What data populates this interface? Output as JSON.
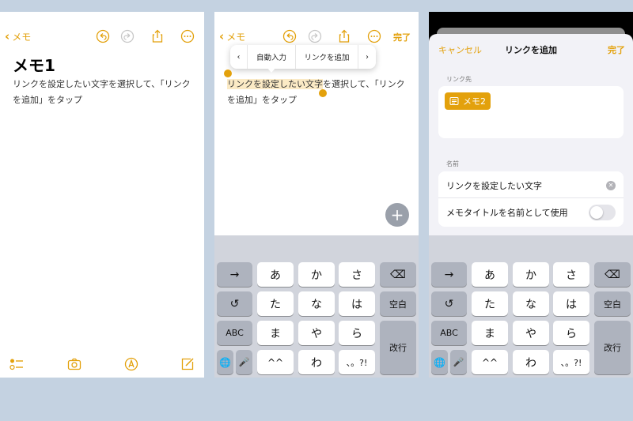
{
  "accent_color": "#e3a10c",
  "panel1": {
    "back_label": "メモ",
    "title": "メモ1",
    "body": "リンクを設定したい文字を選択して、「リンクを追加」をタップ",
    "icons": [
      "undo-icon",
      "redo-icon",
      "share-icon",
      "more-icon",
      "checklist-icon",
      "camera-icon",
      "markup-icon",
      "compose-icon"
    ]
  },
  "panel2": {
    "back_label": "メモ",
    "done_label": "完了",
    "menu": {
      "prev": "‹",
      "autofill": "自動入力",
      "add_link": "リンクを追加",
      "next": "›"
    },
    "selected_text": "リンクを設定したい文字",
    "body_rest_1": "を選択して、「リンク",
    "body_rest_2": "を追加」をタップ",
    "fab": "+"
  },
  "keyboard": {
    "arrow": "→",
    "undo": "↺",
    "abc": "ABC",
    "globe": "🌐",
    "mic": "🎤",
    "row1": [
      "あ",
      "か",
      "さ"
    ],
    "row2": [
      "た",
      "な",
      "は"
    ],
    "row3": [
      "ま",
      "や",
      "ら"
    ],
    "row4": [
      "^^",
      "わ",
      "、。?!"
    ],
    "delete": "⌫",
    "space": "空白",
    "return": "改行"
  },
  "panel3": {
    "cancel_label": "キャンセル",
    "title": "リンクを追加",
    "done_label": "完了",
    "link_section_label": "リンク先",
    "link_chip": "メモ2",
    "name_section_label": "名前",
    "name_value": "リンクを設定したい文字",
    "use_title_label": "メモタイトルを名前として使用",
    "use_title_on": false
  }
}
